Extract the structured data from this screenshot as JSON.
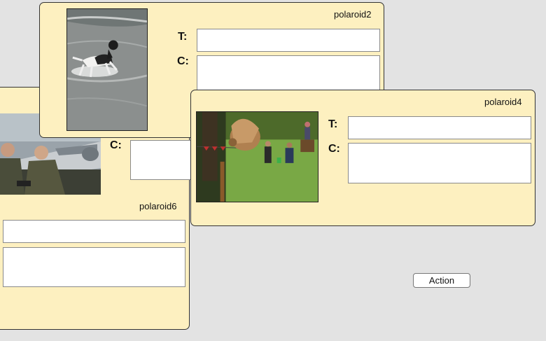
{
  "polaroids": [
    {
      "id": "polaroid6",
      "title": "polaroid6",
      "labels": {
        "t": "T:",
        "c": "C:"
      },
      "title_value": "",
      "caption_value": "",
      "photo": "two pilots in flight suits in front of a jet aircraft"
    },
    {
      "id": "polaroid2",
      "title": "polaroid2",
      "labels": {
        "t": "T:",
        "c": "C:"
      },
      "title_value": "",
      "caption_value": "",
      "photo": "black and white dog running in shallow sea water"
    },
    {
      "id": "polaroid4",
      "title": "polaroid4",
      "labels": {
        "t": "T:",
        "c": "C:"
      },
      "title_value": "",
      "caption_value": "",
      "photo": "owl flying low over a park lawn with spectators"
    }
  ],
  "action_button": {
    "label": "Action"
  }
}
